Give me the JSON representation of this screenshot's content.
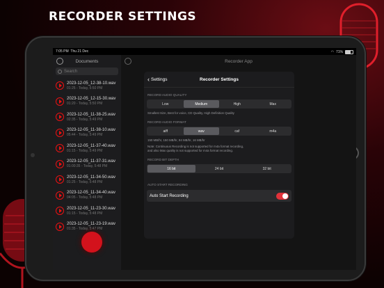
{
  "hero": {
    "title": "RECORDER SETTINGS"
  },
  "status": {
    "time": "7:05 PM",
    "date": "Thu 21 Dec",
    "battery": "71%"
  },
  "sidebar": {
    "title": "Documents",
    "search_placeholder": "Search",
    "recordings": [
      {
        "name": "2023-12-05_12-38-10.wav",
        "meta": "01:25 - Today, 5:50 PM"
      },
      {
        "name": "2023-12-05_12-15-30.wav",
        "meta": "01:20 - Today, 5:50 PM"
      },
      {
        "name": "2023-12-05_11-38-25.wav",
        "meta": "02:35 - Today, 5:49 PM"
      },
      {
        "name": "2023-12-05_11-38-10.wav",
        "meta": "05:44 - Today, 5:49 PM"
      },
      {
        "name": "2023-12-05_11-37-40.wav",
        "meta": "01:15 - Today, 5:49 PM"
      },
      {
        "name": "2023-12-05_11-37-31.wav",
        "meta": "01:00:35 - Today, 5:48 PM"
      },
      {
        "name": "2023-12-05_11-34-50.wav",
        "meta": "01:25 - Today, 5:48 PM"
      },
      {
        "name": "2023-12-05_11-34-40.wav",
        "meta": "04:05 - Today, 5:48 PM"
      },
      {
        "name": "2023-12-05_11-23-30.wav",
        "meta": "01:15 - Today, 5:48 PM"
      },
      {
        "name": "2023-12-05_11-23-19.wav",
        "meta": "01:35 - Today, 5:47 PM"
      }
    ]
  },
  "main": {
    "title": "Recorder App"
  },
  "settings": {
    "back_label": "Settings",
    "title": "Recorder Settings",
    "quality": {
      "label": "RECORD AUDIO QUALITY",
      "options": [
        "Low",
        "Medium",
        "High",
        "Max"
      ],
      "selected": "Medium",
      "note": "Smallest Size, Best for voice, CD Quality, High Definition Quality"
    },
    "format": {
      "label": "RECORD AUDIO FORMAT",
      "options": [
        "aiff",
        "wav",
        "caf",
        "m4a"
      ],
      "selected": "wav",
      "note1": "150 MB/hr, 150 MB/hr, 94 MB/hr, 16 MB/hr",
      "note2": "Note: Continuous Recording is not supported for m4a format recording,",
      "note3": "and also Max quality is not supported for m4a format recording."
    },
    "bitdepth": {
      "label": "RECORD BIT DEPTH",
      "options": [
        "16 bit",
        "24 bit",
        "32 bit"
      ],
      "selected": "16 bit"
    },
    "autostart": {
      "label": "AUTO START RECORDING",
      "row_label": "Auto Start Recording",
      "enabled": true
    }
  },
  "colors": {
    "accent": "#e2323a",
    "record": "#d3121c"
  }
}
